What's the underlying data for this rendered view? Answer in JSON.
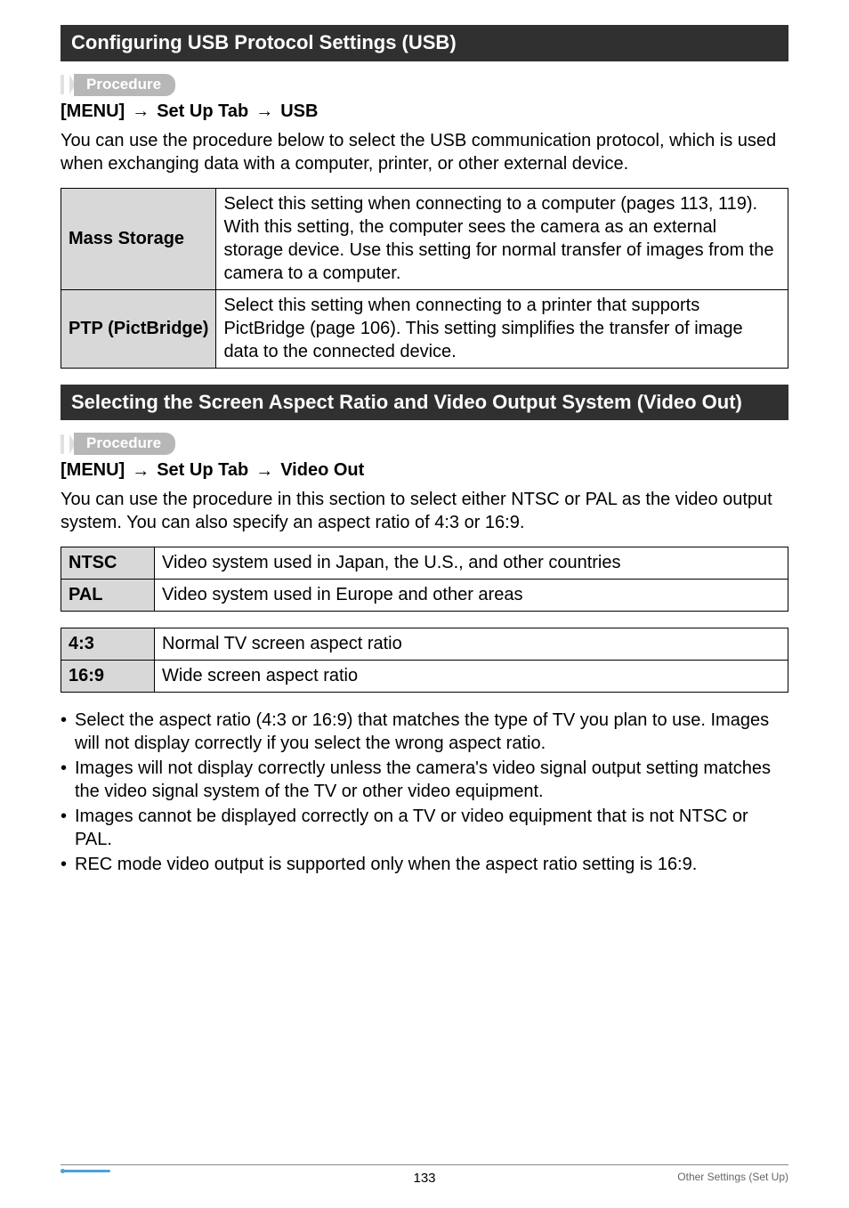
{
  "sections": {
    "usb": {
      "header": "Configuring USB Protocol Settings (USB)",
      "procedure_label": "Procedure",
      "menu_path": {
        "p0": "[MENU]",
        "p1": "Set Up Tab",
        "p2": "USB"
      },
      "intro": "You can use the procedure below to select the USB communication protocol, which is used when exchanging data with a computer, printer, or other external device.",
      "rows": [
        {
          "label": "Mass Storage",
          "desc": "Select this setting when connecting to a computer (pages 113, 119). With this setting, the computer sees the camera as an external storage device. Use this setting for normal transfer of images from the camera to a computer."
        },
        {
          "label": "PTP (PictBridge)",
          "desc": "Select this setting when connecting to a printer that supports PictBridge (page 106). This setting simplifies the transfer of image data to the connected device."
        }
      ]
    },
    "video": {
      "header": "Selecting the Screen Aspect Ratio and Video Output System (Video Out)",
      "procedure_label": "Procedure",
      "menu_path": {
        "p0": "[MENU]",
        "p1": "Set Up Tab",
        "p2": "Video Out"
      },
      "intro": "You can use the procedure in this section to select either NTSC or PAL as the video output system. You can also specify an aspect ratio of 4:3 or 16:9.",
      "systems": [
        {
          "label": "NTSC",
          "desc": "Video system used in Japan, the U.S., and other countries"
        },
        {
          "label": "PAL",
          "desc": "Video system used in Europe and other areas"
        }
      ],
      "ratios": [
        {
          "label": "4:3",
          "desc": "Normal TV screen aspect ratio"
        },
        {
          "label": "16:9",
          "desc": "Wide screen aspect ratio"
        }
      ],
      "bullets": [
        "Select the aspect ratio (4:3 or 16:9) that matches the type of TV you plan to use. Images will not display correctly if you select the wrong aspect ratio.",
        "Images will not display correctly unless the camera's video signal output setting matches the video signal system of the TV or other video equipment.",
        "Images cannot be displayed correctly on a TV or video equipment that is not NTSC or PAL.",
        "REC mode video output is supported only when the aspect ratio setting is 16:9."
      ]
    }
  },
  "footer": {
    "page": "133",
    "section": "Other Settings (Set Up)"
  },
  "glyphs": {
    "arrow": "→",
    "bullet": "•"
  }
}
